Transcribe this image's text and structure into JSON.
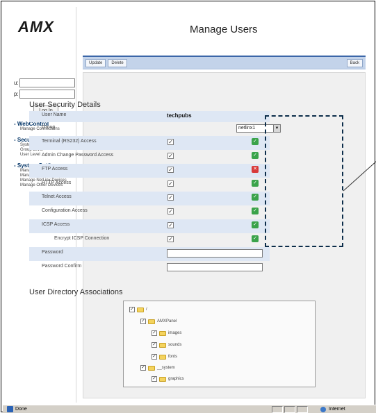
{
  "header": {
    "logo_text": "AMX",
    "page_title": "Manage Users"
  },
  "login": {
    "user_label": "u:",
    "pass_label": "p:",
    "button": "Log In"
  },
  "nav": [
    {
      "title": "- WebControl",
      "items": [
        "Manage Connections"
      ]
    },
    {
      "title": "- Security",
      "items": [
        "System Level",
        "Group Level",
        "User Level"
      ]
    },
    {
      "title": "- System Settings",
      "items": [
        "Manage System",
        "Manage License",
        "Manage NetLinx Devices",
        "Manage Other Devices"
      ]
    }
  ],
  "toolbar": {
    "update": "Update",
    "delete": "Delete",
    "back": "Back"
  },
  "security": {
    "heading": "User Security Details",
    "user_name_label": "User Name",
    "user_name_value": "techpubs",
    "group_label": "Group",
    "group_value": "netlinx1",
    "rows": [
      {
        "label": "Terminal (RS232) Access",
        "status": "ok"
      },
      {
        "label": "Admin Change Password Access",
        "status": "ok"
      },
      {
        "label": "FTP Access",
        "status": "bad"
      },
      {
        "label": "HTTP Access",
        "status": "ok"
      },
      {
        "label": "Telnet Access",
        "status": "ok"
      },
      {
        "label": "Configuration Access",
        "status": "ok"
      },
      {
        "label": "ICSP Access",
        "status": "ok"
      },
      {
        "label": "Encrypt ICSP Connection",
        "status": "ok"
      }
    ],
    "password_label": "Password",
    "password_confirm_label": "Password Confirm"
  },
  "directories": {
    "heading": "User Directory Associations",
    "items": [
      "/",
      "AMXPanel",
      "images",
      "sounds",
      "fonts",
      "__system",
      "graphics"
    ]
  },
  "statusbar": {
    "status": "Done",
    "zone": "Internet"
  },
  "colors": {
    "accent": "#3b66a8",
    "ok": "#3aa34a",
    "bad": "#d83a3a"
  }
}
